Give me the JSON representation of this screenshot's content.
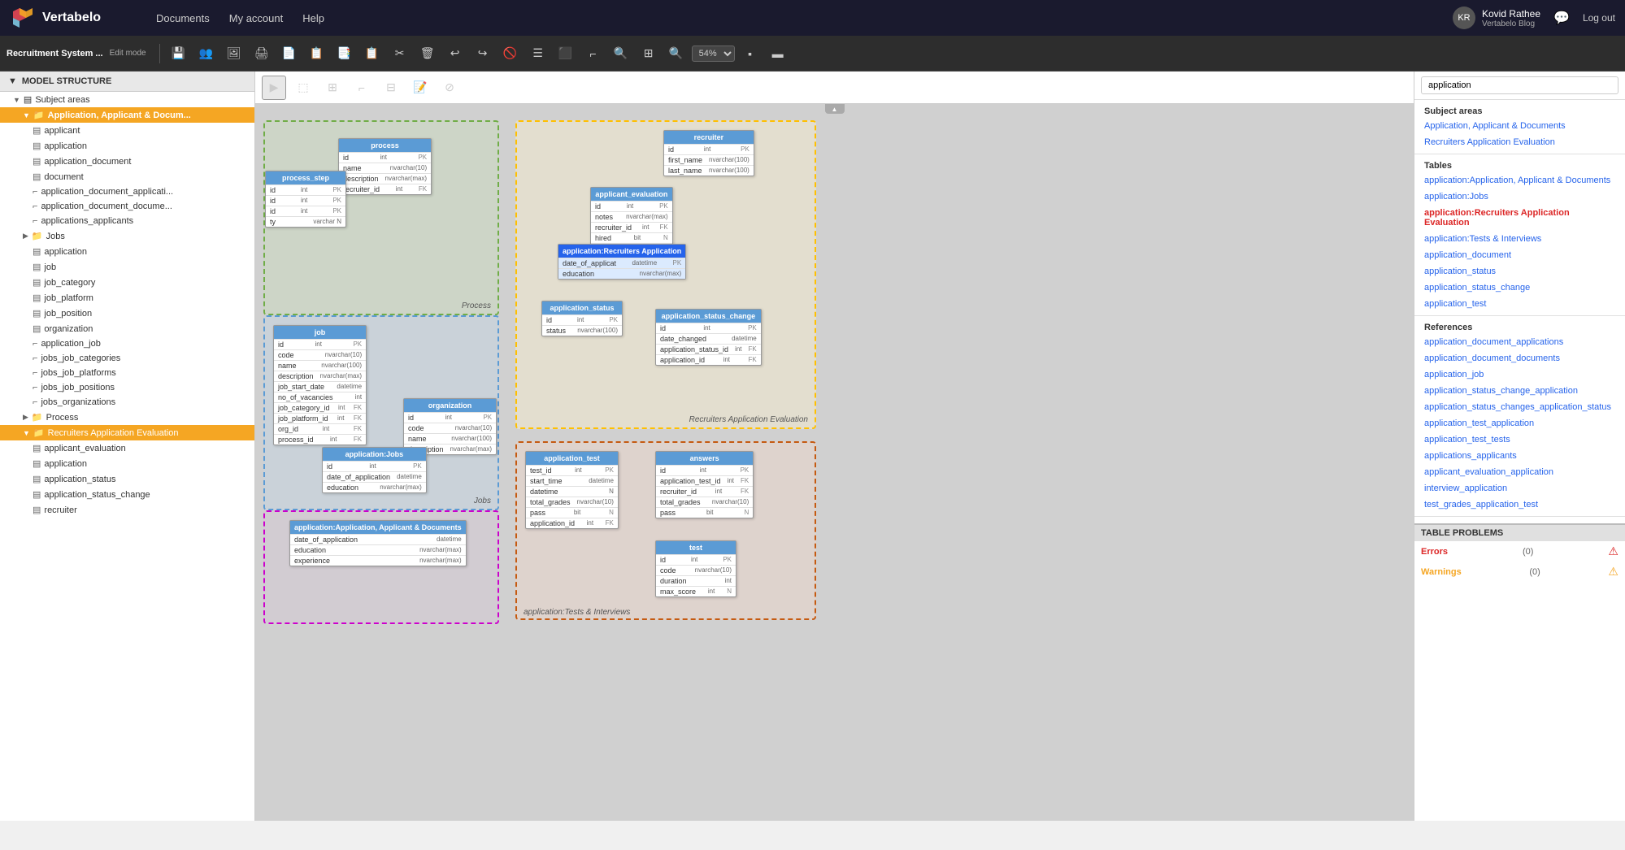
{
  "app": {
    "name": "Vertabelo",
    "title": "Recruitment System ...",
    "edit_mode": "Edit mode"
  },
  "nav": {
    "documents": "Documents",
    "my_account": "My account",
    "help": "Help",
    "user_name": "Kovid Rathee",
    "user_subtitle": "Vertabelo Blog",
    "logout": "Log out"
  },
  "toolbar": {
    "zoom": "54%"
  },
  "left_panel": {
    "title": "MODEL STRUCTURE",
    "subject_areas_label": "Subject areas",
    "items": [
      {
        "id": "sa-main",
        "label": "Subject areas",
        "level": 1,
        "type": "group"
      },
      {
        "id": "aad",
        "label": "Application, Applicant & Docum...",
        "level": 2,
        "type": "folder",
        "active": true
      },
      {
        "id": "applicant",
        "label": "applicant",
        "level": 3,
        "type": "table"
      },
      {
        "id": "application",
        "label": "application",
        "level": 3,
        "type": "table"
      },
      {
        "id": "application_document",
        "label": "application_document",
        "level": 3,
        "type": "table"
      },
      {
        "id": "document",
        "label": "document",
        "level": 3,
        "type": "table"
      },
      {
        "id": "application_document_appli",
        "label": "application_document_applicati...",
        "level": 3,
        "type": "ref"
      },
      {
        "id": "application_document_docume",
        "label": "application_document_docume...",
        "level": 3,
        "type": "ref"
      },
      {
        "id": "applications_applicants",
        "label": "applications_applicants",
        "level": 3,
        "type": "ref"
      },
      {
        "id": "jobs-group",
        "label": "Jobs",
        "level": 2,
        "type": "folder"
      },
      {
        "id": "application-jobs",
        "label": "application",
        "level": 3,
        "type": "table"
      },
      {
        "id": "job",
        "label": "job",
        "level": 3,
        "type": "table"
      },
      {
        "id": "job_category",
        "label": "job_category",
        "level": 3,
        "type": "table"
      },
      {
        "id": "job_platform",
        "label": "job_platform",
        "level": 3,
        "type": "table"
      },
      {
        "id": "job_position",
        "label": "job_position",
        "level": 3,
        "type": "table"
      },
      {
        "id": "organization",
        "label": "organization",
        "level": 3,
        "type": "table"
      },
      {
        "id": "application_job",
        "label": "application_job",
        "level": 3,
        "type": "ref"
      },
      {
        "id": "jobs_job_categories",
        "label": "jobs_job_categories",
        "level": 3,
        "type": "ref"
      },
      {
        "id": "jobs_job_platforms",
        "label": "jobs_job_platforms",
        "level": 3,
        "type": "ref"
      },
      {
        "id": "jobs_job_positions",
        "label": "jobs_job_positions",
        "level": 3,
        "type": "ref"
      },
      {
        "id": "jobs_organizations",
        "label": "jobs_organizations",
        "level": 3,
        "type": "ref"
      },
      {
        "id": "process-group",
        "label": "Process",
        "level": 2,
        "type": "folder"
      },
      {
        "id": "rae",
        "label": "Recruiters Application Evaluation",
        "level": 2,
        "type": "folder",
        "active2": true
      },
      {
        "id": "applicant_evaluation",
        "label": "applicant_evaluation",
        "level": 3,
        "type": "table"
      },
      {
        "id": "application-rae",
        "label": "application",
        "level": 3,
        "type": "table"
      },
      {
        "id": "application_status",
        "label": "application_status",
        "level": 3,
        "type": "table"
      },
      {
        "id": "application_status_change",
        "label": "application_status_change",
        "level": 3,
        "type": "table"
      },
      {
        "id": "recruiter",
        "label": "recruiter",
        "level": 3,
        "type": "table"
      }
    ]
  },
  "right_panel": {
    "search_placeholder": "application",
    "subject_areas_label": "Subject areas",
    "subject_areas": [
      "Application, Applicant & Documents",
      "Recruiters Application Evaluation"
    ],
    "tables_label": "Tables",
    "tables": [
      "application:Application, Applicant & Documents",
      "application:Jobs",
      "application:Recruiters Application Evaluation",
      "application:Tests & Interviews",
      "application_document",
      "application_status",
      "application_status_change",
      "application_test"
    ],
    "references_label": "References",
    "references": [
      "application_document_applications",
      "application_document_documents",
      "application_job",
      "application_status_change_application",
      "application_status_changes_application_status",
      "application_test_application",
      "application_test_tests",
      "applications_applicants",
      "applicant_evaluation_application",
      "interview_application",
      "test_grades_application_test"
    ],
    "table_problems": "TABLE PROBLEMS",
    "errors_label": "Errors",
    "errors_count": "(0)",
    "warnings_label": "Warnings",
    "warnings_count": "(0)"
  },
  "diagram": {
    "areas": [
      {
        "label": "Process",
        "color": "#c6e0b4"
      },
      {
        "label": "Jobs",
        "color": "#bdd7ee"
      },
      {
        "label": "Recruiters Application Evaluation",
        "color": "#fff2cc"
      },
      {
        "label": "Application: Tests & Interviews",
        "color": "#e2efda"
      }
    ]
  }
}
